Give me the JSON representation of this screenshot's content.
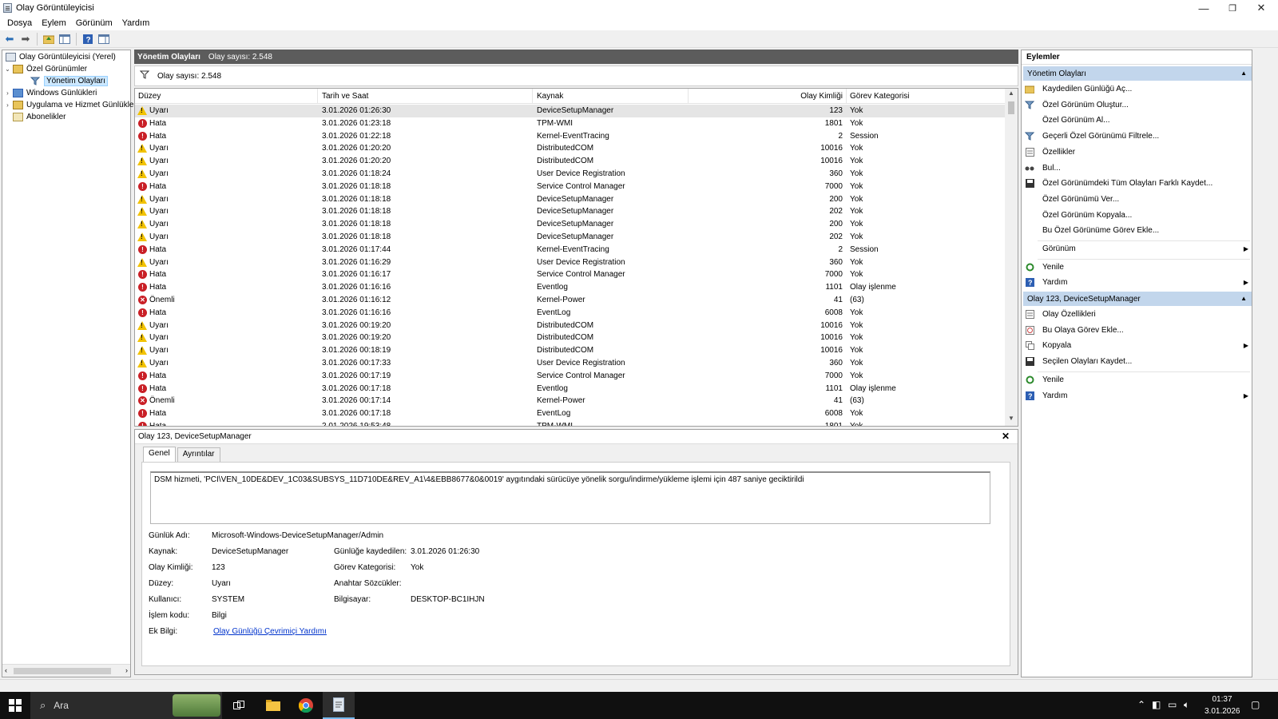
{
  "window": {
    "title": "Olay Görüntüleyicisi",
    "minimize": "—",
    "restore": "❐",
    "close": "✕"
  },
  "menu": [
    "Dosya",
    "Eylem",
    "Görünüm",
    "Yardım"
  ],
  "tree": {
    "root": "Olay Görüntüleyicisi (Yerel)",
    "custom_views": "Özel Görünümler",
    "admin_events": "Yönetim Olayları",
    "windows_logs": "Windows Günlükleri",
    "app_service_logs": "Uygulama ve Hizmet Günlükleri",
    "subscriptions": "Abonelikler"
  },
  "center": {
    "title": "Yönetim Olayları",
    "count_label": "Olay sayısı: 2.548",
    "filter_count": "Olay sayısı: 2.548"
  },
  "columns": {
    "level": "Düzey",
    "date": "Tarih ve Saat",
    "source": "Kaynak",
    "id": "Olay Kimliği",
    "category": "Görev Kategorisi"
  },
  "events": [
    {
      "level": "Uyarı",
      "type": "warn",
      "date": "3.01.2026 01:26:30",
      "source": "DeviceSetupManager",
      "id": "123",
      "category": "Yok"
    },
    {
      "level": "Hata",
      "type": "err",
      "date": "3.01.2026 01:23:18",
      "source": "TPM-WMI",
      "id": "1801",
      "category": "Yok"
    },
    {
      "level": "Hata",
      "type": "err",
      "date": "3.01.2026 01:22:18",
      "source": "Kernel-EventTracing",
      "id": "2",
      "category": "Session"
    },
    {
      "level": "Uyarı",
      "type": "warn",
      "date": "3.01.2026 01:20:20",
      "source": "DistributedCOM",
      "id": "10016",
      "category": "Yok"
    },
    {
      "level": "Uyarı",
      "type": "warn",
      "date": "3.01.2026 01:20:20",
      "source": "DistributedCOM",
      "id": "10016",
      "category": "Yok"
    },
    {
      "level": "Uyarı",
      "type": "warn",
      "date": "3.01.2026 01:18:24",
      "source": "User Device Registration",
      "id": "360",
      "category": "Yok"
    },
    {
      "level": "Hata",
      "type": "err",
      "date": "3.01.2026 01:18:18",
      "source": "Service Control Manager",
      "id": "7000",
      "category": "Yok"
    },
    {
      "level": "Uyarı",
      "type": "warn",
      "date": "3.01.2026 01:18:18",
      "source": "DeviceSetupManager",
      "id": "200",
      "category": "Yok"
    },
    {
      "level": "Uyarı",
      "type": "warn",
      "date": "3.01.2026 01:18:18",
      "source": "DeviceSetupManager",
      "id": "202",
      "category": "Yok"
    },
    {
      "level": "Uyarı",
      "type": "warn",
      "date": "3.01.2026 01:18:18",
      "source": "DeviceSetupManager",
      "id": "200",
      "category": "Yok"
    },
    {
      "level": "Uyarı",
      "type": "warn",
      "date": "3.01.2026 01:18:18",
      "source": "DeviceSetupManager",
      "id": "202",
      "category": "Yok"
    },
    {
      "level": "Hata",
      "type": "err",
      "date": "3.01.2026 01:17:44",
      "source": "Kernel-EventTracing",
      "id": "2",
      "category": "Session"
    },
    {
      "level": "Uyarı",
      "type": "warn",
      "date": "3.01.2026 01:16:29",
      "source": "User Device Registration",
      "id": "360",
      "category": "Yok"
    },
    {
      "level": "Hata",
      "type": "err",
      "date": "3.01.2026 01:16:17",
      "source": "Service Control Manager",
      "id": "7000",
      "category": "Yok"
    },
    {
      "level": "Hata",
      "type": "err",
      "date": "3.01.2026 01:16:16",
      "source": "Eventlog",
      "id": "1101",
      "category": "Olay işlenme"
    },
    {
      "level": "Önemli",
      "type": "crit",
      "date": "3.01.2026 01:16:12",
      "source": "Kernel-Power",
      "id": "41",
      "category": "(63)"
    },
    {
      "level": "Hata",
      "type": "err",
      "date": "3.01.2026 01:16:16",
      "source": "EventLog",
      "id": "6008",
      "category": "Yok"
    },
    {
      "level": "Uyarı",
      "type": "warn",
      "date": "3.01.2026 00:19:20",
      "source": "DistributedCOM",
      "id": "10016",
      "category": "Yok"
    },
    {
      "level": "Uyarı",
      "type": "warn",
      "date": "3.01.2026 00:19:20",
      "source": "DistributedCOM",
      "id": "10016",
      "category": "Yok"
    },
    {
      "level": "Uyarı",
      "type": "warn",
      "date": "3.01.2026 00:18:19",
      "source": "DistributedCOM",
      "id": "10016",
      "category": "Yok"
    },
    {
      "level": "Uyarı",
      "type": "warn",
      "date": "3.01.2026 00:17:33",
      "source": "User Device Registration",
      "id": "360",
      "category": "Yok"
    },
    {
      "level": "Hata",
      "type": "err",
      "date": "3.01.2026 00:17:19",
      "source": "Service Control Manager",
      "id": "7000",
      "category": "Yok"
    },
    {
      "level": "Hata",
      "type": "err",
      "date": "3.01.2026 00:17:18",
      "source": "Eventlog",
      "id": "1101",
      "category": "Olay işlenme"
    },
    {
      "level": "Önemli",
      "type": "crit",
      "date": "3.01.2026 00:17:14",
      "source": "Kernel-Power",
      "id": "41",
      "category": "(63)"
    },
    {
      "level": "Hata",
      "type": "err",
      "date": "3.01.2026 00:17:18",
      "source": "EventLog",
      "id": "6008",
      "category": "Yok"
    },
    {
      "level": "Hata",
      "type": "err",
      "date": "2.01.2026 19:53:48",
      "source": "TPM-WMI",
      "id": "1801",
      "category": "Yok"
    }
  ],
  "detail": {
    "title": "Olay 123, DeviceSetupManager",
    "close": "✕",
    "tabs": [
      "Genel",
      "Ayrıntılar"
    ],
    "description": "DSM hizmeti, 'PCI\\VEN_10DE&DEV_1C03&SUBSYS_11D710DE&REV_A1\\4&EBB8677&0&0019' aygıtındaki sürücüye yönelik sorgu/indirme/yükleme işlemi için 487 saniye geciktirildi",
    "labels": {
      "log_name": "Günlük Adı:",
      "source": "Kaynak:",
      "event_id": "Olay Kimliği:",
      "level": "Düzey:",
      "user": "Kullanıcı:",
      "opcode": "İşlem kodu:",
      "more_info": "Ek Bilgi:",
      "logged": "Günlüğe kaydedilen:",
      "category": "Görev Kategorisi:",
      "keywords": "Anahtar Sözcükler:",
      "computer": "Bilgisayar:"
    },
    "values": {
      "log_name": "Microsoft-Windows-DeviceSetupManager/Admin",
      "source": "DeviceSetupManager",
      "event_id": "123",
      "level": "Uyarı",
      "user": "SYSTEM",
      "opcode": "Bilgi",
      "more_info": "Olay Günlüğü Çevrimiçi Yardımı",
      "logged": "3.01.2026 01:26:30",
      "category": "Yok",
      "keywords": "",
      "computer": "DESKTOP-BC1IHJN"
    }
  },
  "actions": {
    "title": "Eylemler",
    "section1": "Yönetim Olayları",
    "section1_items": [
      {
        "label": "Kaydedilen Günlüğü Aç...",
        "icon": "open-log-icon"
      },
      {
        "label": "Özel Görünüm Oluştur...",
        "icon": "filter-icon"
      },
      {
        "label": "Özel Görünüm Al...",
        "icon": ""
      },
      {
        "label": "Geçerli Özel Görünümü Filtrele...",
        "icon": "filter-icon"
      },
      {
        "label": "Özellikler",
        "icon": "properties-icon"
      },
      {
        "label": "Bul...",
        "icon": "find-icon"
      },
      {
        "label": "Özel Görünümdeki Tüm Olayları Farklı Kaydet...",
        "icon": "save-icon"
      },
      {
        "label": "Özel Görünümü Ver...",
        "icon": ""
      },
      {
        "label": "Özel Görünüm Kopyala...",
        "icon": ""
      },
      {
        "label": "Bu Özel Görünüme Görev Ekle...",
        "icon": ""
      },
      {
        "label": "Görünüm",
        "icon": ""
      },
      {
        "label": "Yenile",
        "icon": "refresh-icon"
      },
      {
        "label": "Yardım",
        "icon": "help-icon"
      }
    ],
    "section2": "Olay 123, DeviceSetupManager",
    "section2_items": [
      {
        "label": "Olay Özellikleri",
        "icon": "properties-icon"
      },
      {
        "label": "Bu Olaya Görev Ekle...",
        "icon": "task-icon"
      },
      {
        "label": "Kopyala",
        "icon": "copy-icon"
      },
      {
        "label": "Seçilen Olayları Kaydet...",
        "icon": "save-icon"
      },
      {
        "label": "Yenile",
        "icon": "refresh-icon"
      },
      {
        "label": "Yardım",
        "icon": "help-icon"
      }
    ]
  },
  "taskbar": {
    "search_placeholder": "Ara",
    "time": "01:37",
    "date": "3.01.2026"
  },
  "colors": {
    "selected_section": "#c2d6ec",
    "header_dark": "#5c5c5c",
    "warning": "#f2c200",
    "error": "#c91f26",
    "link": "#0033cc"
  }
}
